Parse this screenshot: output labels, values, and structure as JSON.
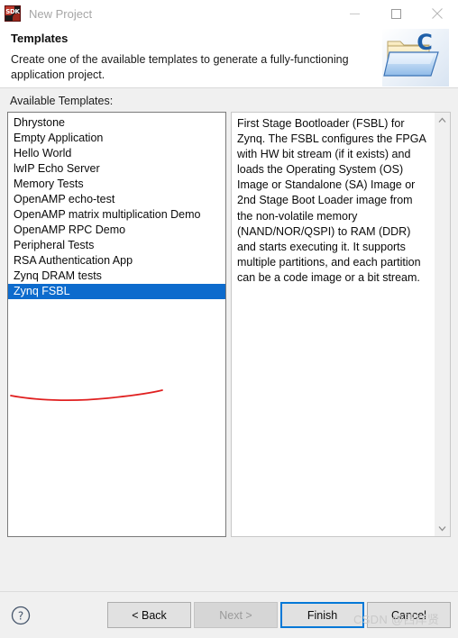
{
  "window": {
    "title": "New Project",
    "app_icon": "sdk-icon",
    "icon_text": "SDK",
    "controls": [
      {
        "name": "minimize-button",
        "icon": "minimize-icon"
      },
      {
        "name": "maximize-button",
        "icon": "maximize-icon"
      },
      {
        "name": "close-button",
        "icon": "close-icon"
      }
    ]
  },
  "header": {
    "title": "Templates",
    "description": "Create one of the available templates to generate a fully-functioning application project.",
    "banner_icon": "new-c-project-folder-icon"
  },
  "content": {
    "available_label": "Available Templates:",
    "templates": [
      "Dhrystone",
      "Empty Application",
      "Hello World",
      "lwIP Echo Server",
      "Memory Tests",
      "OpenAMP echo-test",
      "OpenAMP matrix multiplication Demo",
      "OpenAMP RPC Demo",
      "Peripheral Tests",
      "RSA Authentication App",
      "Zynq DRAM tests",
      "Zynq FSBL"
    ],
    "selected_template": "Zynq FSBL",
    "selected_index": 11,
    "description": "First Stage Bootloader (FSBL) for Zynq. The FSBL configures the FPGA with HW bit stream (if it exists)  and loads the Operating System (OS) Image or Standalone (SA) Image or 2nd Stage Boot Loader image from the  non-volatile memory (NAND/NOR/QSPI) to RAM (DDR) and starts executing it.  It supports multiple partitions,  and each partition can be a code image or a bit stream.",
    "scrollbar": {
      "up_icon": "chevron-up-icon",
      "down_icon": "chevron-down-icon"
    },
    "annotation": {
      "name": "red-underline-annotation",
      "color": "#e02020"
    }
  },
  "footer": {
    "help_icon": "help-circle-icon",
    "buttons": [
      {
        "name": "back-button",
        "label": "< Back",
        "state": "enabled"
      },
      {
        "name": "next-button",
        "label": "Next >",
        "state": "disabled"
      },
      {
        "name": "finish-button",
        "label": "Finish",
        "state": "default"
      },
      {
        "name": "cancel-button",
        "label": "Cancel",
        "state": "enabled"
      }
    ]
  },
  "watermark": {
    "prefix": "CSDN @",
    "suffix": "西岸贤"
  },
  "colors": {
    "selection_blue": "#0d6bcd",
    "focus_blue": "#0078d7",
    "dialog_background": "#f0f0f0",
    "annotation_red": "#e02020"
  }
}
